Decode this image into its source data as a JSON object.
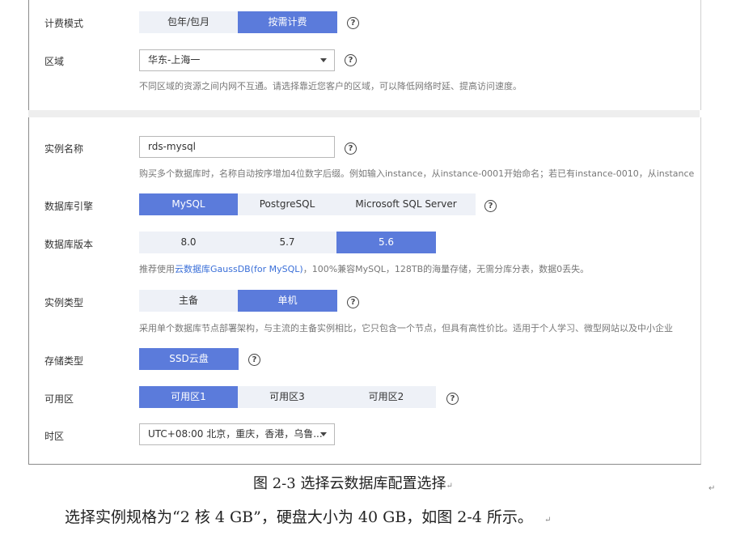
{
  "billing": {
    "label": "计费模式",
    "options": [
      "包年/包月",
      "按需计费"
    ],
    "selected": "按需计费"
  },
  "region": {
    "label": "区域",
    "value": "华东-上海一",
    "hint": "不同区域的资源之间内网不互通。请选择靠近您客户的区域，可以降低网络时延、提高访问速度。"
  },
  "instance_name": {
    "label": "实例名称",
    "value": "rds-mysql",
    "hint": "购买多个数据库时，名称自动按序增加4位数字后缀。例如输入instance，从instance-0001开始命名；若已有instance-0010，从instance"
  },
  "engine": {
    "label": "数据库引擎",
    "options": [
      "MySQL",
      "PostgreSQL",
      "Microsoft SQL Server"
    ],
    "selected": "MySQL"
  },
  "version": {
    "label": "数据库版本",
    "options": [
      "8.0",
      "5.7",
      "5.6"
    ],
    "selected": "5.6",
    "hint_prefix": "推荐使用",
    "hint_link": "云数据库GaussDB(for MySQL)",
    "hint_suffix": "，100%兼容MySQL，128TB的海量存储，无需分库分表，数据0丢失。"
  },
  "instance_type": {
    "label": "实例类型",
    "options": [
      "主备",
      "单机"
    ],
    "selected": "单机",
    "hint": "采用单个数据库节点部署架构，与主流的主备实例相比，它只包含一个节点，但具有高性价比。适用于个人学习、微型网站以及中小企业"
  },
  "storage": {
    "label": "存储类型",
    "options": [
      "SSD云盘"
    ],
    "selected": "SSD云盘"
  },
  "az": {
    "label": "可用区",
    "options": [
      "可用区1",
      "可用区3",
      "可用区2"
    ],
    "selected": "可用区1"
  },
  "timezone": {
    "label": "时区",
    "value": "UTC+08:00 北京，重庆，香港，乌鲁..."
  },
  "help_glyph": "?",
  "caption": {
    "fig": "图 2-3",
    "text": " 选择云数据库配置选择",
    "mark": "↵"
  },
  "paragraph": {
    "text": "选择实例规格为“2 核 4 GB”，硬盘大小为 40 GB，如图 2-4 所示。",
    "mark": "↵"
  },
  "stray_mark": "↵",
  "colors": {
    "accent": "#5b7bdb",
    "option_bg": "#eef1f7",
    "link": "#3a6fd8"
  }
}
